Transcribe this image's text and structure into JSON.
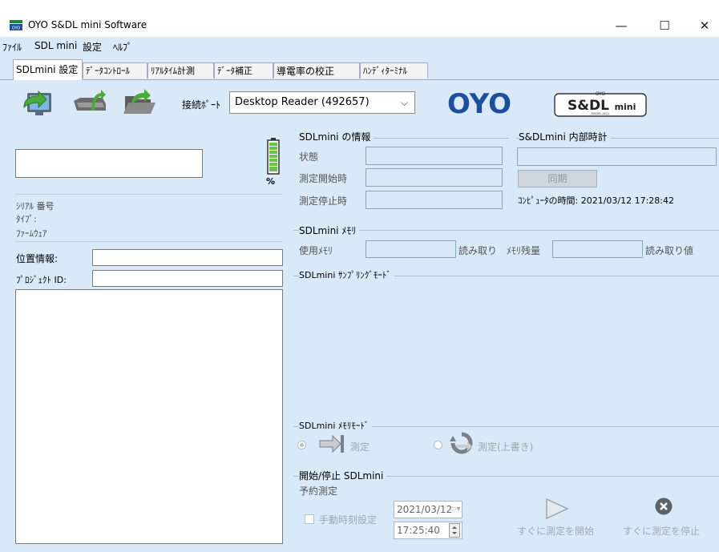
{
  "window": {
    "title": "OYO S&DL mini Software",
    "minimize": "—",
    "maximize": "☐",
    "close": "✕"
  },
  "menubar": {
    "items": [
      "ﾌｧｲﾙ",
      "SDL mini",
      "設定",
      "ﾍﾙﾌﾟ"
    ]
  },
  "tabs": [
    {
      "label": "SDLmini 設定",
      "active": true
    },
    {
      "label": "ﾃﾞｰﾀｺﾝﾄﾛｰﾙ",
      "active": false
    },
    {
      "label": "ﾘｱﾙﾀｲﾑ計測",
      "active": false
    },
    {
      "label": "ﾃﾞｰﾀ補正",
      "active": false
    },
    {
      "label": "導電率の校正",
      "active": false
    },
    {
      "label": "ﾊﾝﾃﾞｨﾀｰﾐﾅﾙ",
      "active": false
    }
  ],
  "toolbar": {
    "port_label": "接続ﾎﾟｰﾄ",
    "port_value": "Desktop Reader (492657)",
    "icons": [
      "send-settings-icon",
      "read-device-icon",
      "open-folder-icon"
    ],
    "oyo_logo": "OYO",
    "sdl_logo": {
      "top": "OYO",
      "main": "S&DL",
      "mini": "mini",
      "model": "MODEL-4021"
    }
  },
  "left": {
    "percent": "%",
    "serial_label": "ｼﾘｱﾙ 番号",
    "type_label": "ﾀｲﾌﾟ:",
    "firmware_label": "ﾌｧｰﾑｳｪｱ",
    "location_label": "位置情報:",
    "project_label": "ﾌﾟﾛｼﾞｪｸﾄ ID:"
  },
  "info": {
    "title": "SDLmini の情報",
    "status": "状態",
    "start_time": "測定開始時",
    "stop_time": "測定停止時"
  },
  "clock": {
    "title": "S&DLmini 内部時計",
    "sync": "同期",
    "computer_time": "ｺﾝﾋﾟｭｰﾀの時間: 2021/03/12 17:28:42"
  },
  "memory": {
    "title": "SDLmini ﾒﾓﾘ",
    "used_label": "使用ﾒﾓﾘ",
    "read_label": "読み取り",
    "remaining_label": "ﾒﾓﾘ残量",
    "read_value_label": "読み取り値"
  },
  "sampling": {
    "title": "SDLmini ｻﾝﾌﾟﾘﾝｸﾞﾓｰﾄﾞ"
  },
  "memory_mode": {
    "title": "SDLmini ﾒﾓﾘﾓｰﾄﾞ",
    "option1": "測定",
    "option2": "測定(上書き)"
  },
  "startstop": {
    "title": "開始/停止 SDLmini",
    "reserve": "予約測定",
    "manual_label": "手動時刻設定",
    "date": "2021/03/12",
    "time": "17:25:40",
    "start_now": "すぐに測定を開始",
    "stop_now": "すぐに測定を停止"
  }
}
